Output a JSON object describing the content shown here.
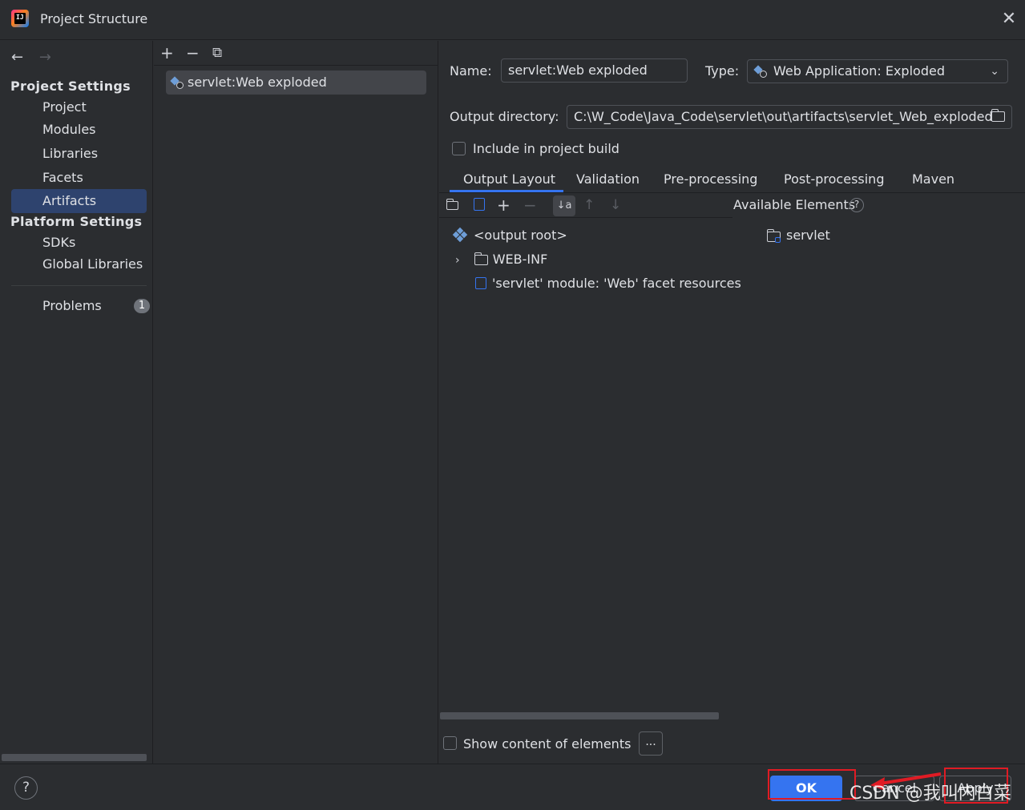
{
  "window": {
    "title": "Project Structure",
    "close_glyph": "✕"
  },
  "nav": {
    "back_glyph": "←",
    "forward_glyph": "→",
    "project_settings_title": "Project Settings",
    "project_items": [
      "Project",
      "Modules",
      "Libraries",
      "Facets",
      "Artifacts"
    ],
    "selected": "Artifacts",
    "platform_settings_title": "Platform Settings",
    "platform_items": [
      "SDKs",
      "Global Libraries"
    ],
    "problems_label": "Problems",
    "problems_count": "1"
  },
  "artifacts_list": {
    "toolbar": {
      "add_glyph": "+",
      "remove_glyph": "−",
      "copy_glyph": "⧉"
    },
    "items": [
      "servlet:Web exploded"
    ]
  },
  "details": {
    "name_label": "Name:",
    "name_value": "servlet:Web exploded",
    "type_label": "Type:",
    "type_value": "Web Application: Exploded",
    "output_dir_label": "Output directory:",
    "output_dir_value": "C:\\W_Code\\Java_Code\\servlet\\out\\artifacts\\servlet_Web_exploded",
    "include_build_label": "Include in project build",
    "include_build_checked": false,
    "tabs": [
      "Output Layout",
      "Validation",
      "Pre-processing",
      "Post-processing",
      "Maven"
    ],
    "active_tab": "Output Layout",
    "available_elements_label": "Available Elements",
    "tree": [
      "<output root>",
      "WEB-INF",
      "'servlet' module: 'Web' facet resources"
    ],
    "available": [
      "servlet"
    ],
    "show_content_label": "Show content of elements",
    "show_content_checked": false,
    "dots_label": "..."
  },
  "footer": {
    "help_glyph": "?",
    "ok_label": "OK",
    "cancel_label": "Cancel",
    "apply_label": "Apply"
  },
  "watermark": "CSDN @我叫内白菜",
  "colors": {
    "accent": "#3574f0",
    "background": "#2b2d30",
    "selection": "#2e436e",
    "annotation": "#e01b24"
  }
}
